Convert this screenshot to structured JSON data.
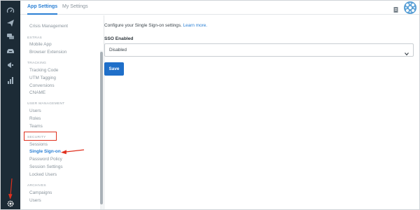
{
  "rail": {
    "icons": [
      "gauge-icon",
      "send-icon",
      "messages-icon",
      "inbox-icon",
      "megaphone-icon",
      "bar-chart-icon"
    ],
    "bottom_icon": "gear-icon"
  },
  "topbar": {
    "tabs": [
      {
        "label": "App Settings",
        "active": true
      },
      {
        "label": "My Settings",
        "active": false
      }
    ],
    "avatar_color": "#5aa0d6"
  },
  "sidebar": {
    "top_item": "Crisis Management",
    "sections": [
      {
        "header": "EXTRAS",
        "items": [
          "Mobile App",
          "Browser Extension"
        ]
      },
      {
        "header": "TRACKING",
        "items": [
          "Tracking Code",
          "UTM Tagging",
          "Conversions",
          "CNAME"
        ]
      },
      {
        "header": "USER MANAGEMENT",
        "items": [
          "Users",
          "Roles",
          "Teams"
        ]
      },
      {
        "header": "SECURITY",
        "items": [
          "Sessions",
          "Single Sign-on",
          "Password Policy",
          "Session Settings",
          "Locked Users"
        ]
      },
      {
        "header": "ARCHIVES",
        "items": [
          "Campaigns",
          "Users"
        ]
      }
    ],
    "active_item": "Single Sign-on"
  },
  "main": {
    "intro_text": "Configure your Single Sign-on settings.",
    "intro_link": "Learn more.",
    "field_label": "SSO Enabled",
    "select_value": "Disabled",
    "save_label": "Save"
  },
  "colors": {
    "accent": "#2a7fd4",
    "rail_bg": "#1c2b36",
    "annotation": "#e0301e",
    "button": "#1f6fc9"
  }
}
